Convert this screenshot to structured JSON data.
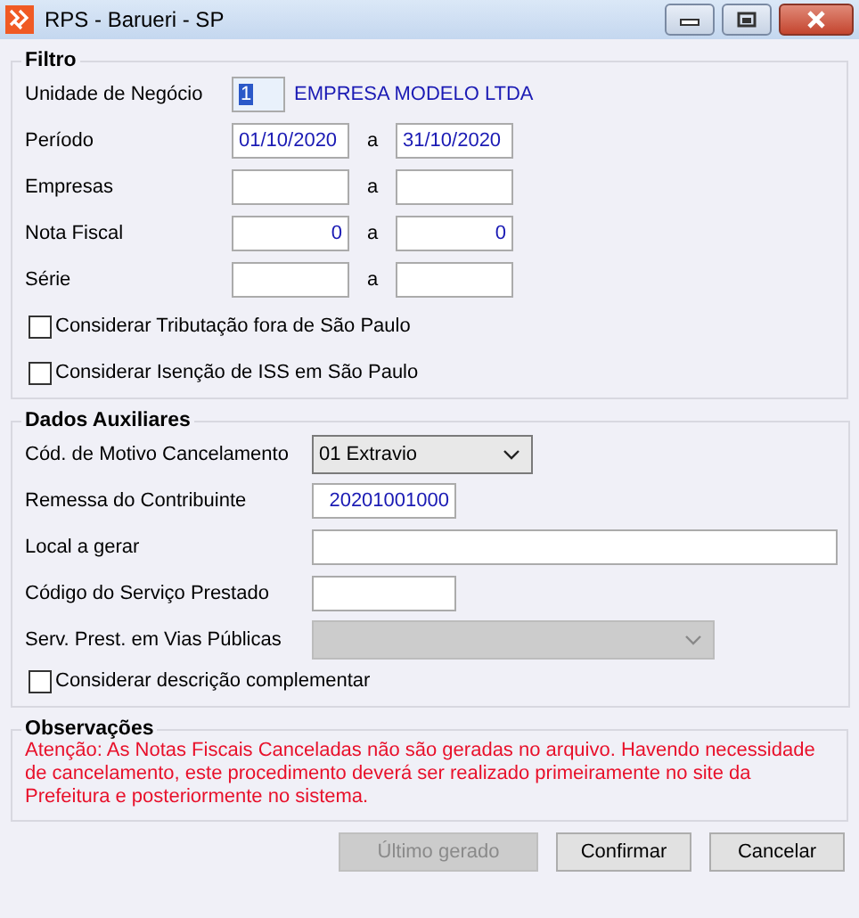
{
  "window": {
    "title": "RPS - Barueri - SP"
  },
  "filtro": {
    "title": "Filtro",
    "unidade": {
      "label": "Unidade de Negócio",
      "code": "1",
      "name": "EMPRESA MODELO LTDA"
    },
    "ranges": [
      {
        "label": "Período",
        "from": "01/10/2020",
        "separator": "a",
        "to": "31/10/2020"
      },
      {
        "label": "Empresas",
        "separator": "a"
      },
      {
        "label": "Nota Fiscal",
        "from": "0",
        "separator": "a",
        "to": "0"
      },
      {
        "label": "Série",
        "separator": "a"
      }
    ],
    "checkboxes": [
      {
        "label": "Considerar Tributação fora de São Paulo",
        "checked": false
      },
      {
        "label": "Considerar Isenção de ISS em São Paulo",
        "checked": false
      }
    ]
  },
  "dados": {
    "title": "Dados Auxiliares",
    "fields": [
      {
        "kind": "select",
        "label": "Cód. de Motivo Cancelamento",
        "value": "01 Extravio",
        "disabled": false
      },
      {
        "kind": "text",
        "label": "Remessa do Contribuinte",
        "value": "20201001000"
      },
      {
        "kind": "text",
        "label": "Local a gerar"
      },
      {
        "kind": "text",
        "label": "Código do Serviço Prestado"
      },
      {
        "kind": "select",
        "label": "Serv. Prest. em Vias Públicas",
        "disabled": true
      }
    ],
    "checkboxes": [
      {
        "label": "Considerar descrição complementar",
        "checked": false
      }
    ]
  },
  "observacoes": {
    "title": "Observações",
    "text": "Atenção: As Notas Fiscais Canceladas não são geradas no arquivo. Havendo necessidade de cancelamento, este procedimento deverá ser realizado primeiramente no site da Prefeitura e posteriormente no sistema."
  },
  "buttons": [
    {
      "label": "Último gerado",
      "disabled": true
    },
    {
      "label": "Confirmar",
      "disabled": false
    },
    {
      "label": "Cancelar",
      "disabled": false
    }
  ]
}
